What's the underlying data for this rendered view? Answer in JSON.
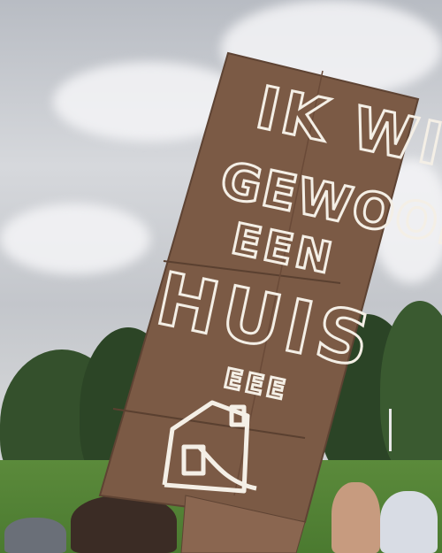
{
  "scene": {
    "description_free": true
  },
  "sign": {
    "line1": "IK WIL",
    "line2": "GEWOON",
    "line3": "EEN",
    "line4": "HUIS",
    "line5": "EEE",
    "colors": {
      "cardboard": "#7b5a45",
      "letters": "#f4efe6"
    }
  }
}
